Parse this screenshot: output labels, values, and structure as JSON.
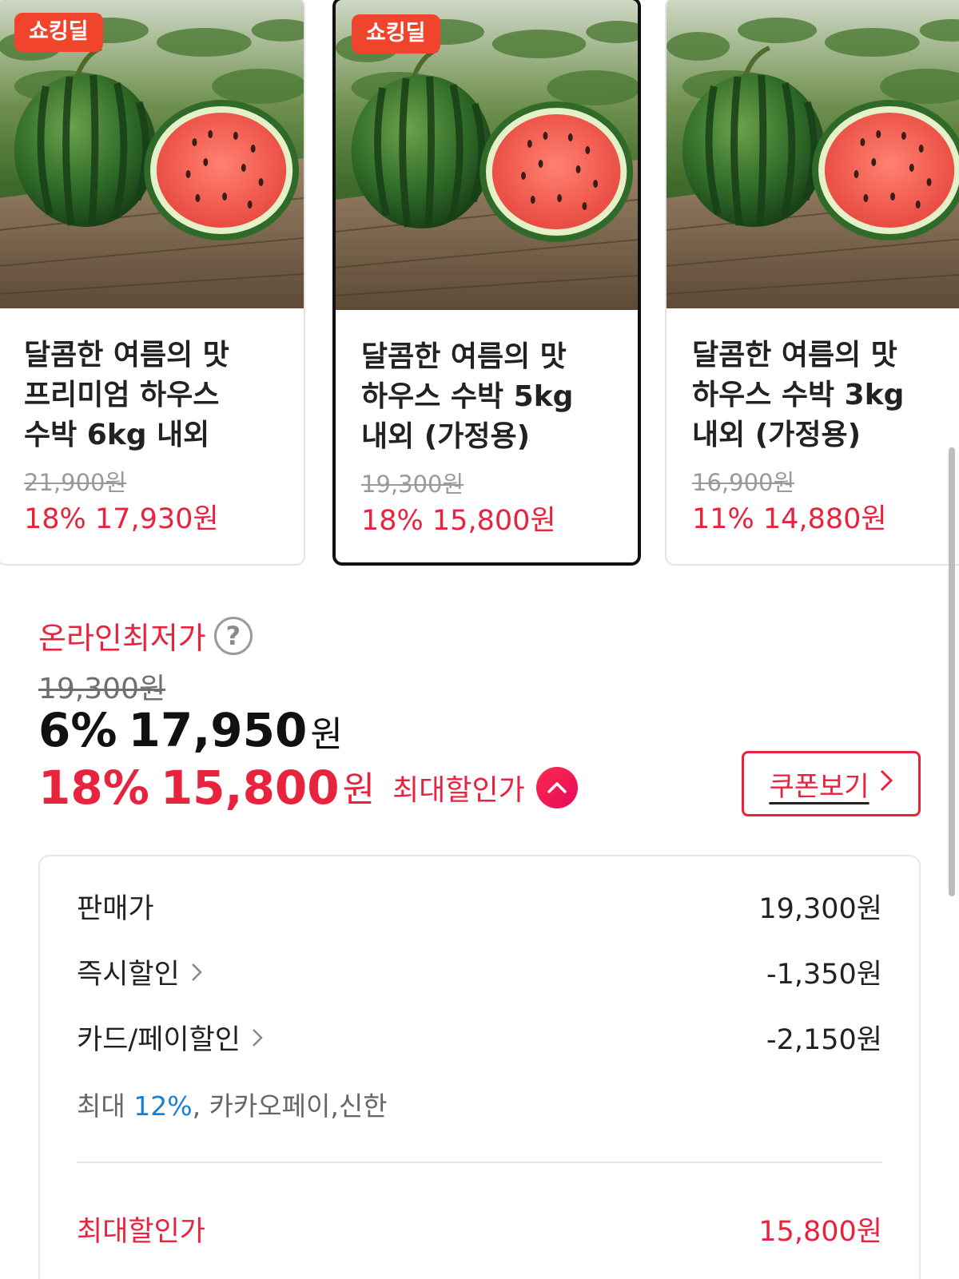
{
  "products": [
    {
      "badge": "쇼킹딜",
      "title": "달콤한 여름의 맛 프리미엄 하우스 수박 6kg 내외",
      "original_price": "21,900원",
      "sale_price": "18% 17,930원",
      "selected": false
    },
    {
      "badge": "쇼킹딜",
      "title": "달콤한 여름의 맛 하우스 수박 5kg 내외 (가정용)",
      "original_price": "19,300원",
      "sale_price": "18% 15,800원",
      "selected": true
    },
    {
      "badge": "",
      "title": "달콤한 여름의 맛 하우스 수박 3kg 내외 (가정용)",
      "original_price": "16,900원",
      "sale_price": "11% 14,880원",
      "selected": false
    }
  ],
  "price": {
    "lowest_label": "온라인최저가",
    "help_icon": "?",
    "original": "19,300원",
    "discount_rate": "6%",
    "discount_amount": "17,950",
    "won": "원",
    "max_rate": "18%",
    "max_amount": "15,800",
    "max_label": "최대할인가",
    "coupon_label": "쿠폰보기"
  },
  "breakdown": {
    "sale_price_label": "판매가",
    "sale_price_value": "19,300원",
    "instant_label": "즉시할인",
    "instant_value": "-1,350원",
    "card_label": "카드/페이할인",
    "card_value": "-2,150원",
    "card_note_prefix": "최대 ",
    "card_note_pct": "12%",
    "card_note_suffix": ", 카카오페이,신한",
    "total_label": "최대할인가",
    "total_value": "15,800원"
  },
  "colors": {
    "accent": "#e8233d",
    "badge": "#f0452c",
    "link_blue": "#1a7fd6"
  }
}
